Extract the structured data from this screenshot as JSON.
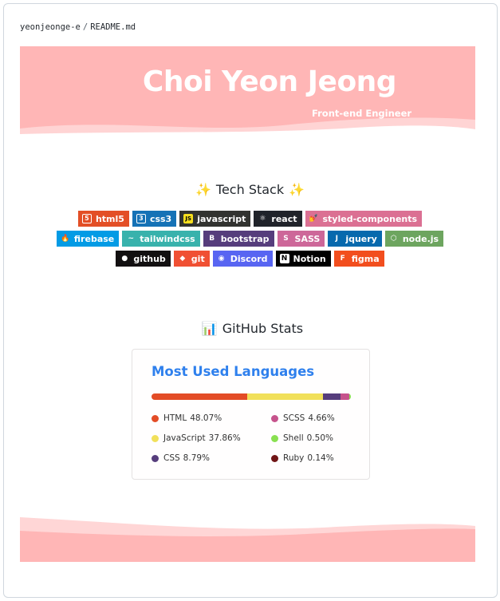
{
  "breadcrumb": {
    "repo": "yeonjeonge-e",
    "file": "README.md"
  },
  "banner": {
    "title": "Choi Yeon Jeong",
    "subtitle": "Front-end Engineer",
    "color": "#ffb6b6",
    "wave_color": "#ffd6d6"
  },
  "tech_stack": {
    "title": "Tech Stack",
    "emoji": "✨",
    "rows": [
      [
        {
          "label": "html5",
          "bg": "#e34f26",
          "icon": "5",
          "icon_name": "html5-icon"
        },
        {
          "label": "css3",
          "bg": "#1572b6",
          "icon": "3",
          "icon_name": "css3-icon"
        },
        {
          "label": "javascript",
          "bg": "#323330",
          "icon": "JS",
          "icon_name": "javascript-icon"
        },
        {
          "label": "react",
          "bg": "#20232a",
          "icon": "⚛",
          "icon_name": "react-icon"
        },
        {
          "label": "styled-components",
          "bg": "#db7093",
          "icon": "💅",
          "icon_name": "styled-components-icon"
        }
      ],
      [
        {
          "label": "firebase",
          "bg": "#039be5",
          "icon": "🔥",
          "icon_name": "firebase-icon"
        },
        {
          "label": "tailwindcss",
          "bg": "#38b2ac",
          "icon": "~",
          "icon_name": "tailwindcss-icon"
        },
        {
          "label": "bootstrap",
          "bg": "#563d7c",
          "icon": "B",
          "icon_name": "bootstrap-icon"
        },
        {
          "label": "SASS",
          "bg": "#cd6799",
          "icon": "S",
          "icon_name": "sass-icon"
        },
        {
          "label": "jquery",
          "bg": "#0769ad",
          "icon": "J",
          "icon_name": "jquery-icon"
        },
        {
          "label": "node.js",
          "bg": "#6da55f",
          "icon": "⬡",
          "icon_name": "nodejs-icon"
        }
      ],
      [
        {
          "label": "github",
          "bg": "#121011",
          "icon": "●",
          "icon_name": "github-icon"
        },
        {
          "label": "git",
          "bg": "#f05033",
          "icon": "◆",
          "icon_name": "git-icon"
        },
        {
          "label": "Discord",
          "bg": "#5865f2",
          "icon": "◉",
          "icon_name": "discord-icon"
        },
        {
          "label": "Notion",
          "bg": "#000000",
          "icon": "N",
          "icon_name": "notion-icon"
        },
        {
          "label": "figma",
          "bg": "#f24e1e",
          "icon": "F",
          "icon_name": "figma-icon"
        }
      ]
    ]
  },
  "github_stats": {
    "title": "GitHub Stats",
    "emoji": "📊",
    "card_title": "Most Used Languages",
    "languages": [
      {
        "name": "HTML",
        "percent": "48.07%",
        "value": 48.07,
        "color": "#e34c26"
      },
      {
        "name": "JavaScript",
        "percent": "37.86%",
        "value": 37.86,
        "color": "#f1e05a"
      },
      {
        "name": "CSS",
        "percent": "8.79%",
        "value": 8.79,
        "color": "#563d7c"
      },
      {
        "name": "SCSS",
        "percent": "4.66%",
        "value": 4.66,
        "color": "#c6538c"
      },
      {
        "name": "Shell",
        "percent": "0.50%",
        "value": 0.5,
        "color": "#89e051"
      },
      {
        "name": "Ruby",
        "percent": "0.14%",
        "value": 0.14,
        "color": "#701516"
      }
    ]
  }
}
